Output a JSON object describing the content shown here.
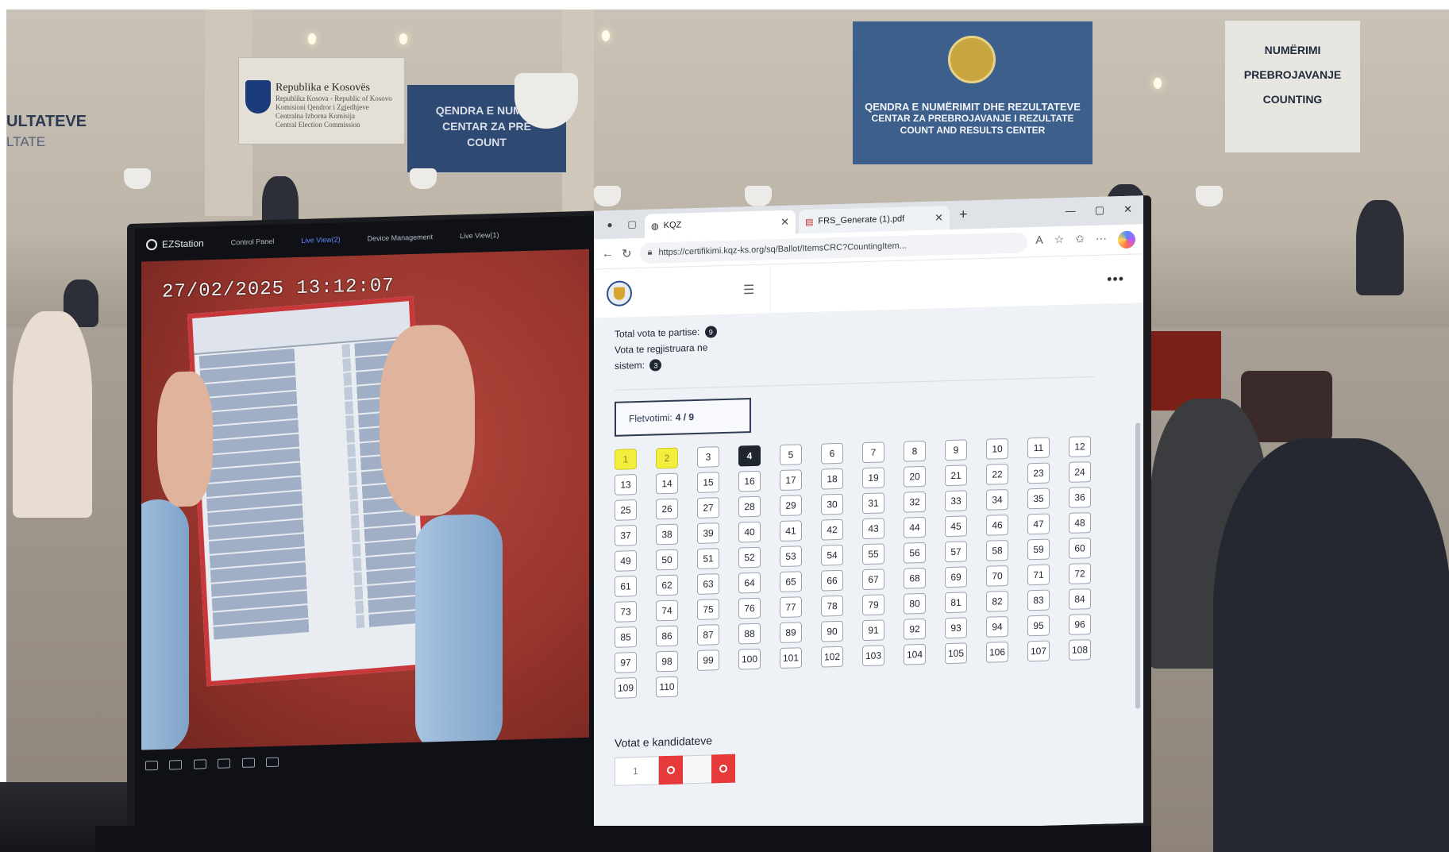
{
  "hall": {
    "sign_left_main": "ULTATEVE",
    "sign_left_sub": "LTATE",
    "sign_rep_title": "Republika e Kosovës",
    "sign_rep_lines": [
      "Republika Kosova - Republic of Kosovo",
      "Komisioni Qendror i Zgjedhjeve",
      "Centralna Izborna Komisija",
      "Central Election Commission"
    ],
    "sign_blue_small": [
      "QENDRA E NUMËR",
      "CENTAR ZA PRE",
      "COUNT"
    ],
    "sign_blue_main": "QENDRA E NUMËRIMIT DHE REZULTATEVE",
    "sign_blue_sub1": "CENTAR ZA PREBROJAVANJE I REZULTATE",
    "sign_blue_sub2": "COUNT AND RESULTS CENTER",
    "sign_white": [
      "NUMËRIMI",
      "PREBROJAVANJE",
      "COUNTING"
    ]
  },
  "ezstation": {
    "app_name": "EZStation",
    "tabs": [
      "Control Panel",
      "Live View(2)",
      "Device Management",
      "Live View(1)"
    ],
    "active_tab_index": 1,
    "timestamp": "27/02/2025  13:12:07"
  },
  "browser": {
    "tabs": [
      {
        "title": "KQZ",
        "icon": "globe-icon"
      },
      {
        "title": "FRS_Generate (1).pdf",
        "icon": "pdf-icon"
      }
    ],
    "url": "https://certifikimi.kqz-ks.org/sq/Ballot/ItemsCRC?CountingItem...",
    "window_controls": [
      "—",
      "▢",
      "✕"
    ]
  },
  "page": {
    "total_label": "Total vota te partise:",
    "total_value": "9",
    "registered_label_1": "Vota te regjistruara ne",
    "registered_label_2": "sistem:",
    "registered_value": "3",
    "ballot_label": "Fletvotimi:",
    "ballot_value": "4 / 9",
    "numbers_total": 110,
    "numbers_done": [
      1,
      2
    ],
    "number_current": 4,
    "candidate_title": "Votat e kandidateve",
    "candidate_input_value": "1"
  },
  "colors": {
    "done": "#f3ee3b",
    "current": "#20262f",
    "remove": "#e5393a",
    "ballot_border": "#c8383a",
    "kqz_blue": "#3d5f8c"
  }
}
